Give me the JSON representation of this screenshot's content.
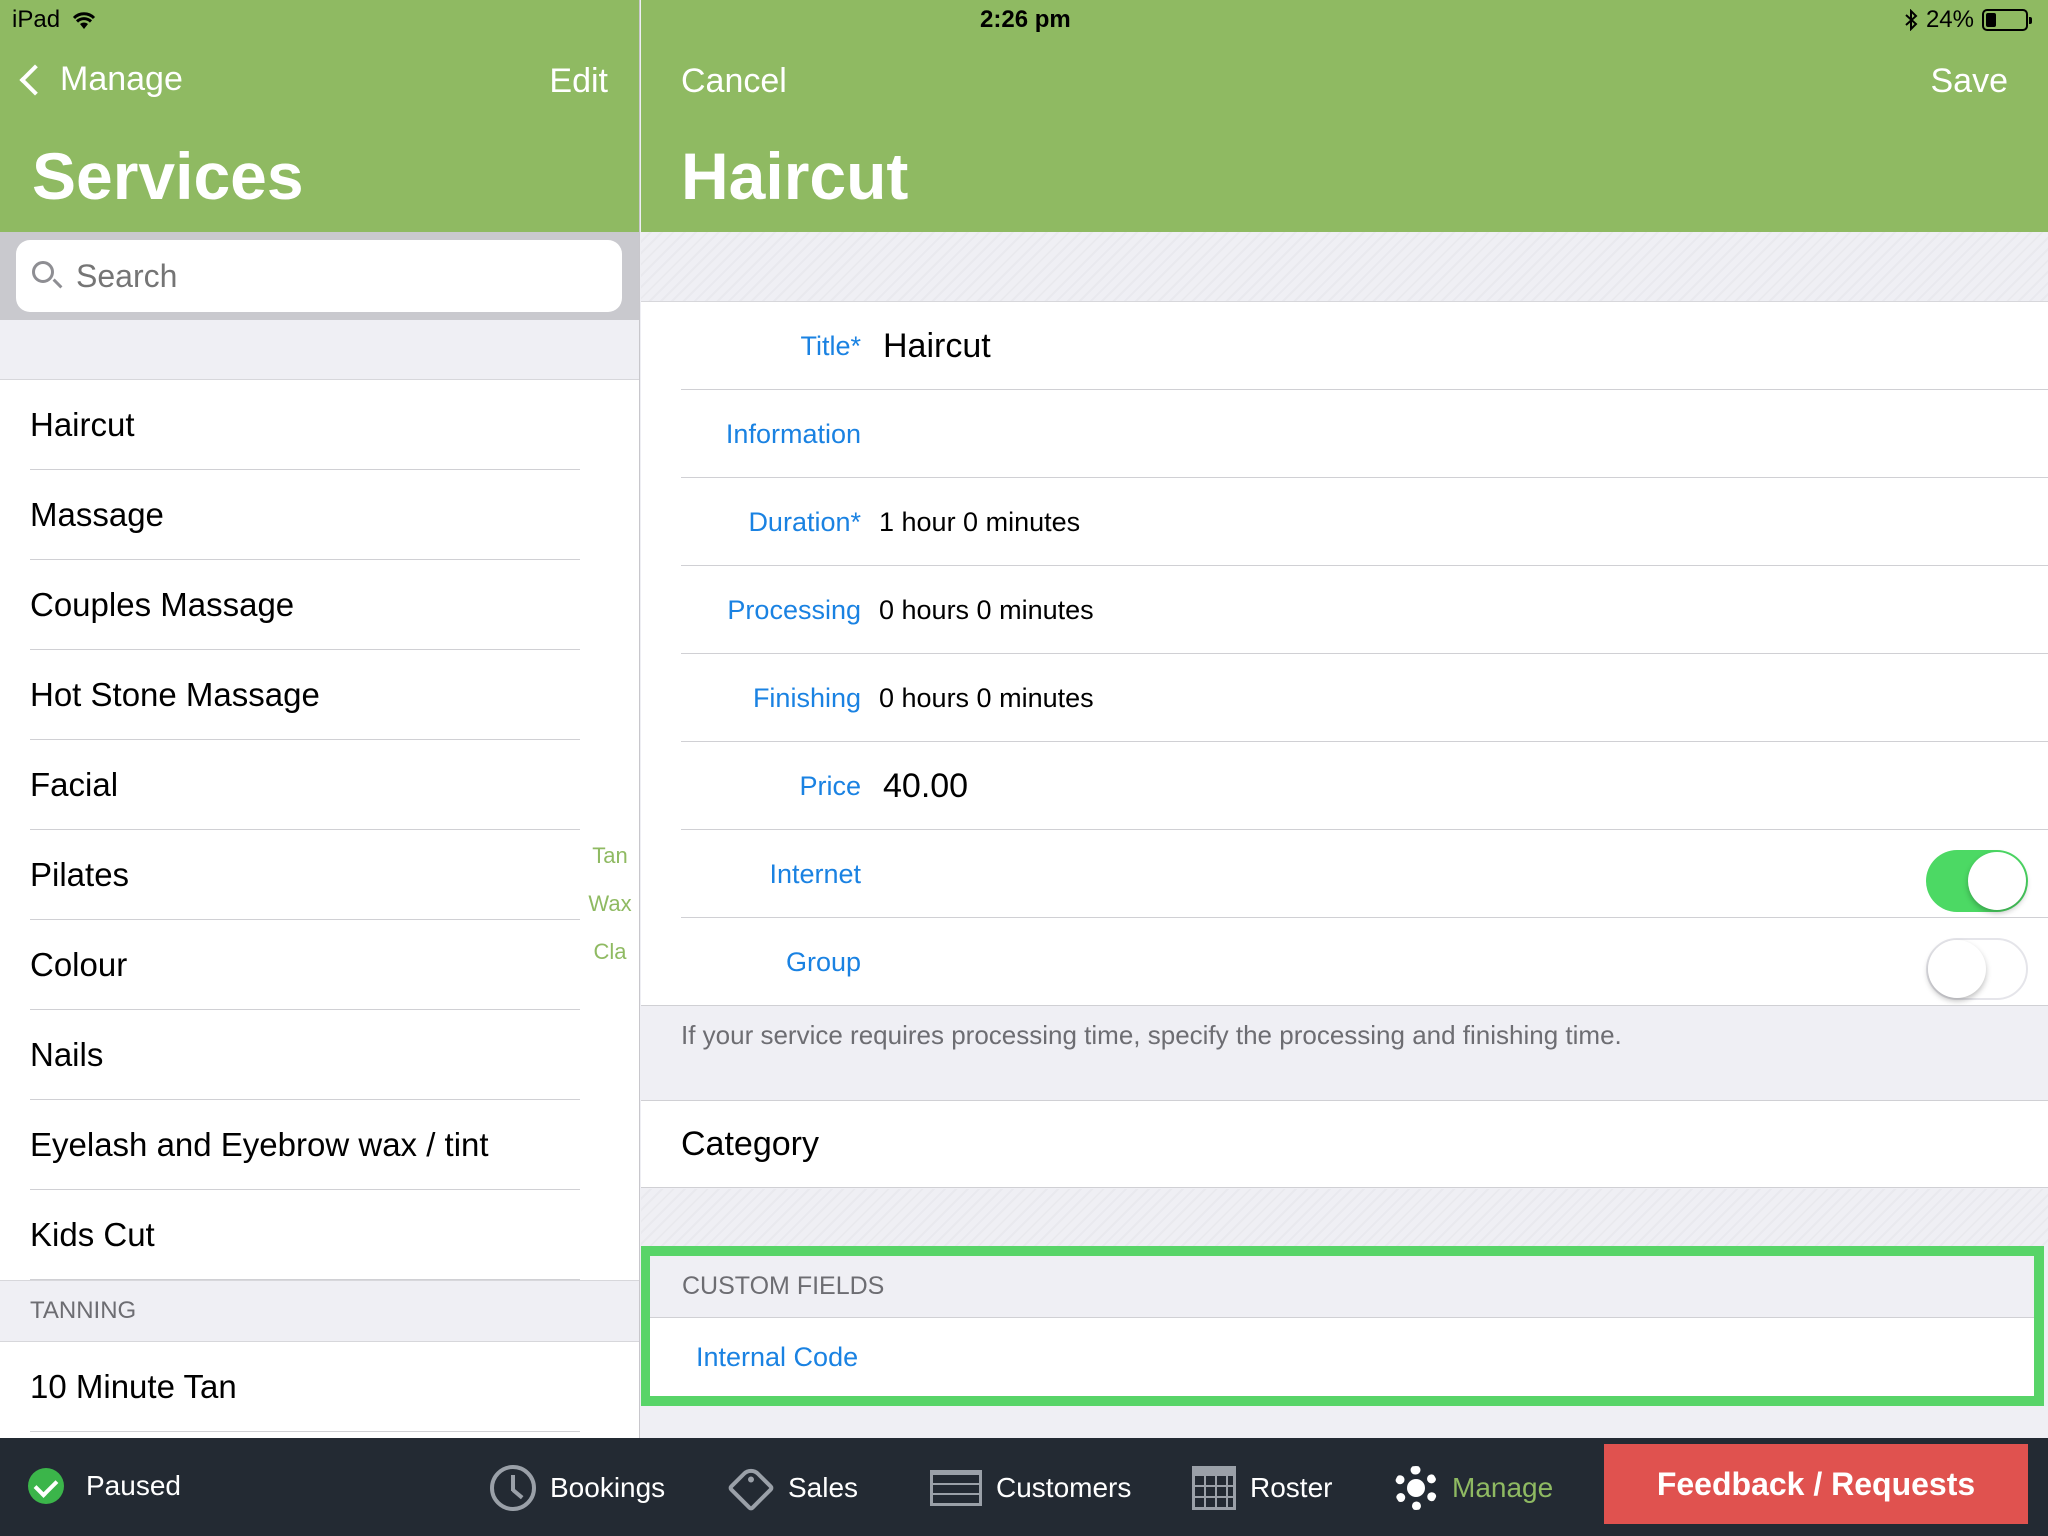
{
  "status_bar": {
    "device": "iPad",
    "time": "2:26 pm",
    "battery": "24%",
    "battery_level": 0.24
  },
  "left_nav": {
    "back_label": "Manage",
    "edit_label": "Edit",
    "title": "Services"
  },
  "search": {
    "placeholder": "Search"
  },
  "services": [
    "Haircut",
    "Massage",
    "Couples Massage",
    "Hot Stone Massage",
    "Facial",
    "Pilates",
    "Colour",
    "Nails",
    "Eyelash and Eyebrow wax / tint",
    "Kids Cut"
  ],
  "section_tanning": {
    "header": "TANNING",
    "items": [
      "10 Minute Tan"
    ]
  },
  "index_letters": [
    "Tan",
    "Wax",
    "Cla"
  ],
  "right_nav": {
    "cancel_label": "Cancel",
    "save_label": "Save",
    "title": "Haircut"
  },
  "form": {
    "title_label": "Title*",
    "title_value": "Haircut",
    "information_label": "Information",
    "duration_label": "Duration*",
    "duration_value": "1 hour 0 minutes",
    "processing_label": "Processing",
    "processing_value": "0 hours 0 minutes",
    "finishing_label": "Finishing",
    "finishing_value": "0 hours 0 minutes",
    "price_label": "Price",
    "price_value": "40.00",
    "internet_label": "Internet",
    "internet_on": true,
    "group_label": "Group",
    "group_on": false,
    "footnote": "If your service requires processing time, specify the processing and finishing time."
  },
  "category_label": "Category",
  "custom_fields": {
    "header": "CUSTOM FIELDS",
    "internal_code_label": "Internal Code"
  },
  "toolbar": {
    "paused_label": "Paused",
    "bookings_label": "Bookings",
    "sales_label": "Sales",
    "customers_label": "Customers",
    "roster_label": "Roster",
    "manage_label": "Manage",
    "feedback_label": "Feedback / Requests"
  },
  "colors": {
    "header_green": "#8fba62",
    "link_blue": "#1a82e2",
    "toggle_green": "#4cd964",
    "highlight_green": "#58d468",
    "toolbar_bg": "#232a33",
    "feedback_red": "#e0524f"
  }
}
